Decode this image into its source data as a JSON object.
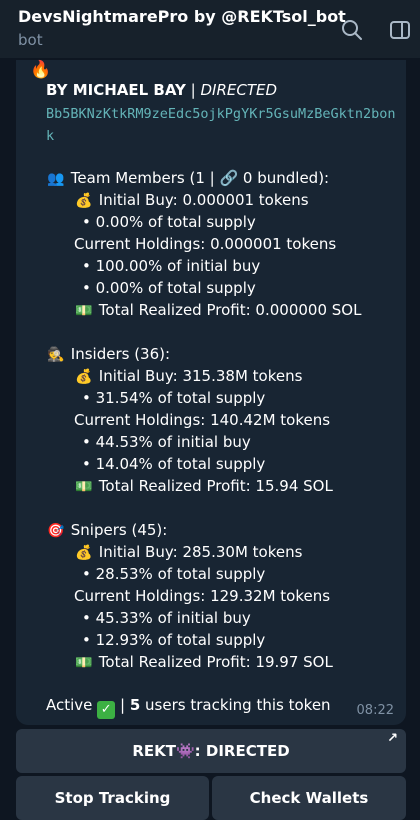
{
  "header": {
    "title": "DevsNightmarePro by @REKTsol_bot",
    "subtitle": "bot"
  },
  "message": {
    "byline_author": "BY MICHAEL BAY",
    "byline_sep": "|",
    "byline_tag": "DIRECTED",
    "address": "Bb5BKNzKtkRM9zeEdc5ojkPgYKr5GsuMzBeGktn2bonk",
    "team": {
      "heading": "Team Members (1 | 🔗 0 bundled):",
      "initial_buy": "Initial Buy: 0.000001 tokens",
      "initial_pct": "• 0.00% of total supply",
      "holdings": "Current Holdings: 0.000001 tokens",
      "holdings_pct_buy": "• 100.00% of initial buy",
      "holdings_pct_supply": "• 0.00% of total supply",
      "profit": "Total Realized Profit: 0.000000 SOL"
    },
    "insiders": {
      "heading": "Insiders (36):",
      "initial_buy": "Initial Buy: 315.38M tokens",
      "initial_pct": "• 31.54% of total supply",
      "holdings": "Current Holdings: 140.42M tokens",
      "holdings_pct_buy": "• 44.53% of initial buy",
      "holdings_pct_supply": "• 14.04% of total supply",
      "profit": "Total Realized Profit: 15.94 SOL"
    },
    "snipers": {
      "heading": "Snipers (45):",
      "initial_buy": "Initial Buy: 285.30M tokens",
      "initial_pct": "• 28.53% of total supply",
      "holdings": "Current Holdings: 129.32M tokens",
      "holdings_pct_buy": "• 45.33% of initial buy",
      "holdings_pct_supply": "• 12.93% of total supply",
      "profit": "Total Realized Profit: 19.97 SOL"
    },
    "footer_active": "Active",
    "footer_sep": "|",
    "footer_count": "5",
    "footer_tracking": "users tracking this token",
    "time": "08:22"
  },
  "buttons": {
    "rekt_prefix": "REKT",
    "rekt_suffix": ": DIRECTED",
    "stop_tracking": "Stop Tracking",
    "check_wallets": "Check Wallets"
  },
  "icons": {
    "fire": "🔥",
    "team": "👥",
    "insider": "🕵",
    "sniper": "🎯",
    "money_bag": "💰",
    "money": "💵",
    "check": "✓",
    "alien": "👾",
    "arrow": "↗"
  }
}
